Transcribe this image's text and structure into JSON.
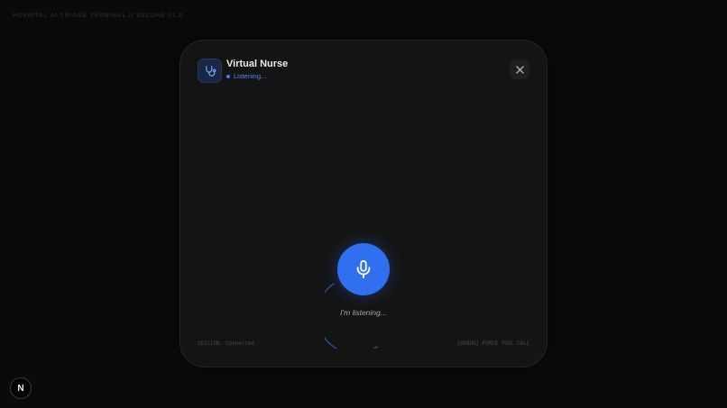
{
  "header": {
    "terminal_label": "HOSPITAL AI TRIAGE TERMINAL // SECURE V1.0"
  },
  "panel": {
    "title": "Virtual Nurse",
    "status": "Listening...",
    "caption": "I'm listening...",
    "session_status": "SESSION: Connected",
    "debug_label": "[DEBUG] FORCE TOOL CALL",
    "icons": {
      "assistant": "stethoscope-icon",
      "close": "close-icon",
      "mic": "microphone-icon"
    }
  },
  "badge": {
    "letter": "N"
  },
  "colors": {
    "accent": "#2f6ff0",
    "status": "#4f8ff0",
    "panel_bg": "#141414",
    "page_bg": "#0a0a0a"
  }
}
